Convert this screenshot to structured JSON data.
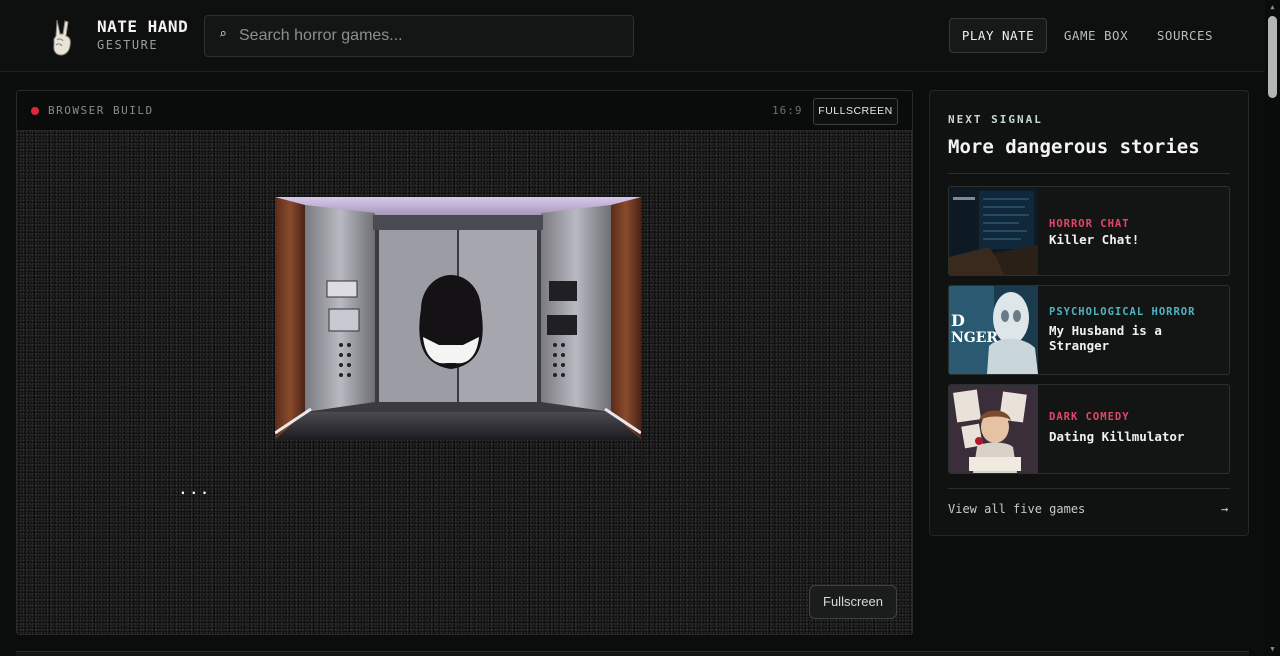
{
  "brand": {
    "title": "NATE HAND",
    "subtitle": "GESTURE"
  },
  "search": {
    "placeholder": "Search horror games..."
  },
  "nav": {
    "items": [
      "PLAY NATE",
      "GAME BOX",
      "SOURCES"
    ],
    "active": "PLAY NATE"
  },
  "player": {
    "label": "BROWSER BUILD",
    "ratio": "16:9",
    "fullscreen_top": "FULLSCREEN",
    "loading_dots": "...",
    "fullscreen_bottom": "Fullscreen"
  },
  "side": {
    "kicker": "NEXT SIGNAL",
    "title": "More dangerous stories",
    "games": [
      {
        "genre": "HORROR CHAT",
        "title": "Killer Chat!",
        "genre_color": "#e0476a"
      },
      {
        "genre": "PSYCHOLOGICAL HORROR",
        "title": "My Husband is a Stranger",
        "genre_color": "#4fb3c2"
      },
      {
        "genre": "DARK COMEDY",
        "title": "Dating Killmulator",
        "genre_color": "#e0476a"
      }
    ],
    "view_all": "View all five games",
    "view_all_arrow": "→"
  },
  "colors": {
    "accent_red": "#e0273a",
    "bg": "#0b0c0c"
  },
  "icons": {
    "logo": "peace-hand-icon",
    "search": "search-icon"
  }
}
